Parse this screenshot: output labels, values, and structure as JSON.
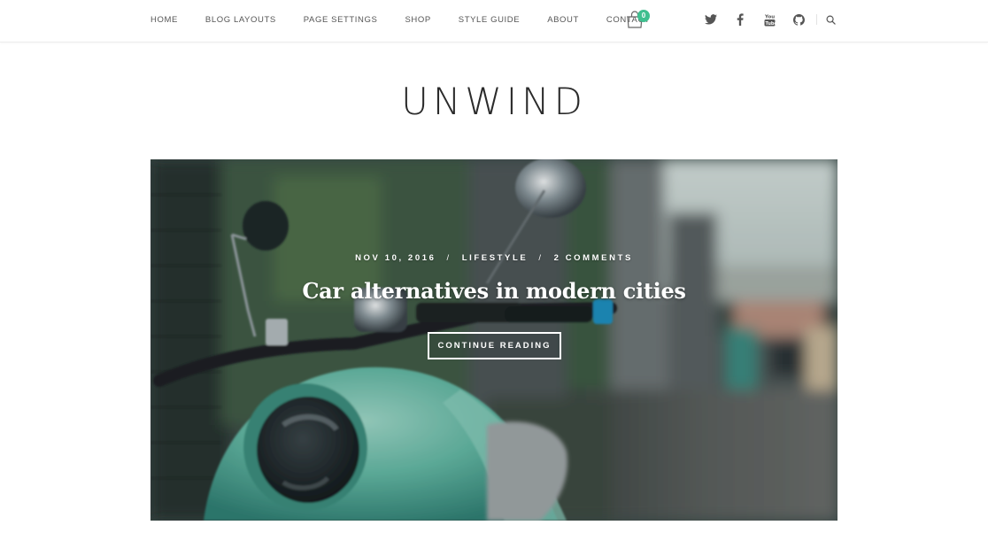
{
  "nav": {
    "items": [
      {
        "label": "Home"
      },
      {
        "label": "Blog Layouts"
      },
      {
        "label": "Page Settings"
      },
      {
        "label": "Shop"
      },
      {
        "label": "Style Guide"
      },
      {
        "label": "About"
      },
      {
        "label": "Contact"
      }
    ],
    "cart": {
      "icon": "shopping-bag-icon",
      "count": "0",
      "badge_color": "#3fbf8f"
    },
    "social": [
      {
        "icon": "twitter-icon"
      },
      {
        "icon": "facebook-icon"
      },
      {
        "icon": "youtube-icon"
      },
      {
        "icon": "github-icon"
      }
    ],
    "search": {
      "icon": "search-icon"
    }
  },
  "site": {
    "title": "UNWIND"
  },
  "featured_post": {
    "date": "Nov 10, 2016",
    "category": "Lifestyle",
    "comments": "2 Comments",
    "separator": "/",
    "title": "Car alternatives in modern cities",
    "cta_label": "Continue Reading",
    "image_subject": "teal scooter in a blurred city alley"
  },
  "colors": {
    "text": "#555555",
    "logo": "#2b2b2b",
    "accent": "#3fbf8f",
    "scooter_teal": "#5fb5a3"
  }
}
